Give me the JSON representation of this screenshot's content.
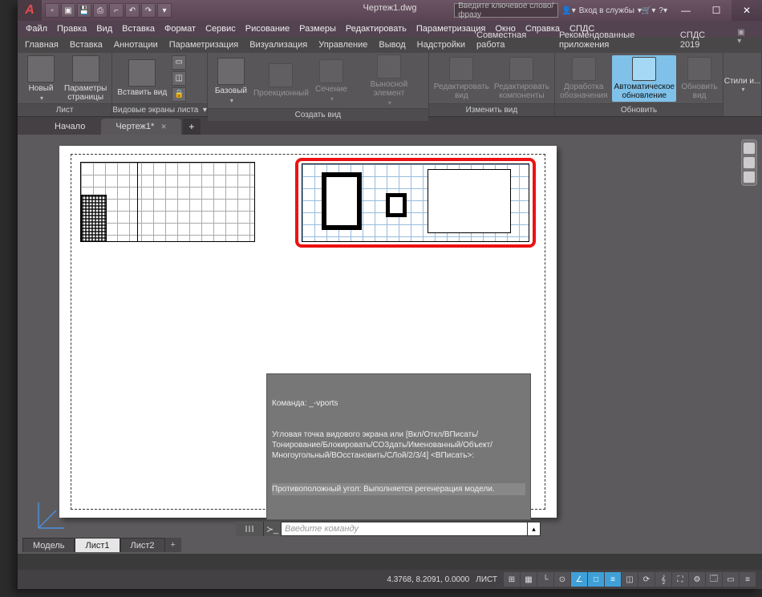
{
  "document_title": "Чертеж1.dwg",
  "search_placeholder": "Введите ключевое слово/фразу",
  "login_label": "Вход в службы",
  "menus": [
    "Файл",
    "Правка",
    "Вид",
    "Вставка",
    "Формат",
    "Сервис",
    "Рисование",
    "Размеры",
    "Редактировать",
    "Параметризация",
    "Окно",
    "Справка",
    "СПДС"
  ],
  "ribbon_tabs": [
    "Главная",
    "Вставка",
    "Аннотации",
    "Параметризация",
    "Визуализация",
    "Управление",
    "Вывод",
    "Надстройки",
    "Совместная работа",
    "Рекомендованные приложения",
    "СПДС 2019"
  ],
  "ribbon": {
    "panel1": {
      "title": "Лист",
      "btn1": "Новый",
      "btn2": "Параметры\nстраницы"
    },
    "panel2": {
      "title": "Видовые экраны листа",
      "btn1": "Вставить вид"
    },
    "panel3": {
      "title": "Создать вид",
      "btn1": "Базовый",
      "btn2": "Проекционный",
      "btn3": "Сечение",
      "btn4": "Выносной элемент"
    },
    "panel4": {
      "title": "Изменить вид",
      "btn1": "Редактировать\nвид",
      "btn2": "Редактировать\nкомпоненты"
    },
    "panel5": {
      "title": "Обновить",
      "btn1": "Доработка\nобозначения",
      "btn2": "Автоматическое\nобновление",
      "btn3": "Обновить\nвид"
    },
    "styles": "Стили и..."
  },
  "doc_tabs": {
    "start": "Начало",
    "active": "Чертеж1*"
  },
  "command": {
    "line1": "Команда: _-vports",
    "line2": "Угловая точка видового экрана или [Вкл/Откл/ВПисать/\nТонирование/Блокировать/СОЗдать/Именованный/Объект/\nМногоугольный/ВОсстановить/СЛой/2/3/4] <ВПисать>:",
    "line3": "Противоположный угол: Выполняется регенерация модели.",
    "placeholder": "Введите команду"
  },
  "sheets": {
    "model": "Модель",
    "sheet1": "Лист1",
    "sheet2": "Лист2"
  },
  "coords": "4.3768, 8.2091, 0.0000",
  "space_label": "ЛИСТ",
  "status_tips": [
    "grid",
    "snap",
    "ortho",
    "polar",
    "osnap",
    "otrack",
    "dyn",
    "lw",
    "tr",
    "qs",
    "ann",
    "ws",
    "full",
    "cfg"
  ]
}
